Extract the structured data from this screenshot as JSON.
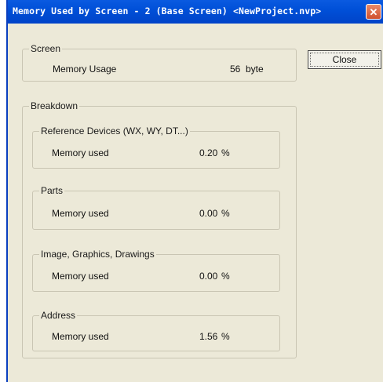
{
  "window": {
    "title": "Memory Used by Screen - 2 (Base Screen) <NewProject.nvp>",
    "close_glyph": "✕"
  },
  "close_button": {
    "label": "Close"
  },
  "screen_group": {
    "title": "Screen",
    "label": "Memory Usage",
    "value": "56",
    "unit": "byte"
  },
  "breakdown": {
    "title": "Breakdown",
    "sections": [
      {
        "title": "Reference Devices (WX, WY, DT...)",
        "label": "Memory used",
        "value": "0.20",
        "unit": "%"
      },
      {
        "title": "Parts",
        "label": "Memory used",
        "value": "0.00",
        "unit": "%"
      },
      {
        "title": "Image, Graphics, Drawings",
        "label": "Memory used",
        "value": "0.00",
        "unit": "%"
      },
      {
        "title": "Address",
        "label": "Memory used",
        "value": "1.56",
        "unit": "%"
      }
    ]
  }
}
